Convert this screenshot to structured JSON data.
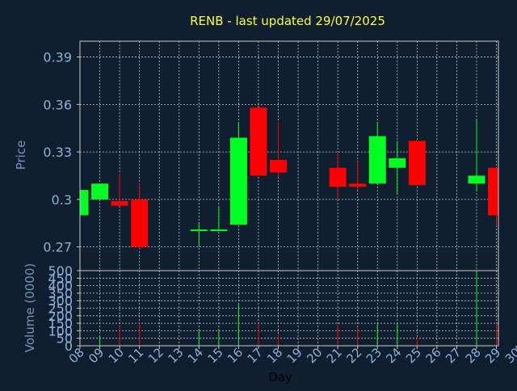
{
  "colors": {
    "background": "#0f1f30",
    "title": "#ffff33",
    "axis_text": "#8fb0d8",
    "axis_label": "#7895b5",
    "up": "#00ff22",
    "down": "#ff0000",
    "grid": "#c8c8c8",
    "frame": "#c8c8c8"
  },
  "chart_data": [
    {
      "type": "candlestick",
      "title": "RENB - last updated 29/07/2025",
      "ylabel": "Price",
      "ylim": [
        0.255,
        0.4
      ],
      "yticks": [
        "0.27",
        "0.3",
        "0.33",
        "0.36",
        "0.39"
      ],
      "grid": true,
      "candles": [
        {
          "day": "08",
          "open": 0.29,
          "close": 0.306,
          "high": 0.306,
          "low": 0.29
        },
        {
          "day": "09",
          "open": 0.3,
          "close": 0.31,
          "high": 0.31,
          "low": 0.3
        },
        {
          "day": "10",
          "open": 0.299,
          "close": 0.296,
          "high": 0.316,
          "low": 0.296
        },
        {
          "day": "11",
          "open": 0.3,
          "close": 0.27,
          "high": 0.31,
          "low": 0.268
        },
        {
          "day": "14",
          "open": 0.28,
          "close": 0.281,
          "high": 0.285,
          "low": 0.27
        },
        {
          "day": "15",
          "open": 0.28,
          "close": 0.281,
          "high": 0.295,
          "low": 0.28
        },
        {
          "day": "16",
          "open": 0.284,
          "close": 0.339,
          "high": 0.349,
          "low": 0.284
        },
        {
          "day": "17",
          "open": 0.358,
          "close": 0.315,
          "high": 0.358,
          "low": 0.315
        },
        {
          "day": "18",
          "open": 0.325,
          "close": 0.317,
          "high": 0.349,
          "low": 0.314
        },
        {
          "day": "21",
          "open": 0.32,
          "close": 0.308,
          "high": 0.33,
          "low": 0.3
        },
        {
          "day": "22",
          "open": 0.31,
          "close": 0.308,
          "high": 0.324,
          "low": 0.306
        },
        {
          "day": "23",
          "open": 0.31,
          "close": 0.34,
          "high": 0.349,
          "low": 0.31
        },
        {
          "day": "24",
          "open": 0.32,
          "close": 0.326,
          "high": 0.337,
          "low": 0.303
        },
        {
          "day": "25",
          "open": 0.337,
          "close": 0.309,
          "high": 0.337,
          "low": 0.309
        },
        {
          "day": "28",
          "open": 0.31,
          "close": 0.315,
          "high": 0.35,
          "low": 0.305
        },
        {
          "day": "29",
          "open": 0.32,
          "close": 0.29,
          "high": 0.32,
          "low": 0.283
        }
      ]
    },
    {
      "type": "bar",
      "ylabel": "Volume (0000)",
      "xlabel": "Day",
      "ylim": [
        0,
        500
      ],
      "yticks": [
        "0",
        "50",
        "100",
        "150",
        "200",
        "250",
        "300",
        "350",
        "400",
        "450",
        "500"
      ],
      "xticks": [
        "08",
        "09",
        "10",
        "11",
        "12",
        "13",
        "14",
        "15",
        "16",
        "17",
        "18",
        "19",
        "20",
        "21",
        "22",
        "23",
        "24",
        "25",
        "26",
        "27",
        "28",
        "29",
        "30"
      ],
      "grid": true,
      "bars": [
        {
          "day": "08",
          "value": 15,
          "direction": "up"
        },
        {
          "day": "09",
          "value": 70,
          "direction": "up"
        },
        {
          "day": "10",
          "value": 130,
          "direction": "down"
        },
        {
          "day": "11",
          "value": 155,
          "direction": "down"
        },
        {
          "day": "14",
          "value": 100,
          "direction": "up"
        },
        {
          "day": "15",
          "value": 100,
          "direction": "up"
        },
        {
          "day": "16",
          "value": 280,
          "direction": "up"
        },
        {
          "day": "17",
          "value": 150,
          "direction": "down"
        },
        {
          "day": "18",
          "value": 80,
          "direction": "down"
        },
        {
          "day": "21",
          "value": 140,
          "direction": "down"
        },
        {
          "day": "22",
          "value": 120,
          "direction": "down"
        },
        {
          "day": "23",
          "value": 145,
          "direction": "up"
        },
        {
          "day": "24",
          "value": 150,
          "direction": "up"
        },
        {
          "day": "25",
          "value": 60,
          "direction": "down"
        },
        {
          "day": "28",
          "value": 495,
          "direction": "up"
        },
        {
          "day": "29",
          "value": 150,
          "direction": "down"
        }
      ]
    }
  ]
}
